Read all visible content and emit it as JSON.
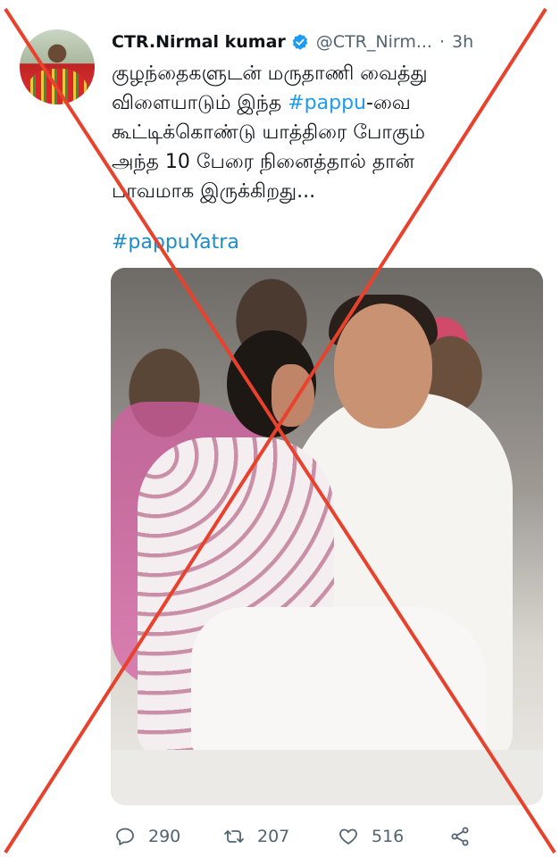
{
  "user": {
    "display_name": "CTR.Nirmal kumar",
    "handle": "@CTR_Nirm...",
    "separator": "·",
    "time": "3h"
  },
  "tweet": {
    "line1": "குழந்தைகளுடன் மருதாணி வைத்து",
    "line2_a": "விளையாடும் இந்த ",
    "line2_hashtag": "#pappu",
    "line2_b": "-வை",
    "line3": "கூட்டிக்கொண்டு யாத்திரை போகும்",
    "line4": "அந்த 10 பேரை நினைத்தால் தான்",
    "line5": "பாவமாக இருக்கிறது...",
    "hashtag": "#pappuYatra"
  },
  "actions": {
    "replies": "290",
    "retweets": "207",
    "likes": "516"
  },
  "colors": {
    "accent": "#1d9bf0",
    "cross": "#e8412c",
    "muted": "#536471"
  },
  "icons": [
    "verified-icon",
    "reply-icon",
    "retweet-icon",
    "like-icon",
    "share-icon"
  ]
}
